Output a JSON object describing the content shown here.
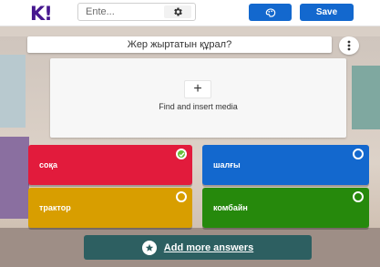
{
  "app": {
    "logo_text": "K!",
    "title_placeholder": "Ente...",
    "save_label": "Save"
  },
  "question": {
    "text": "Жер жыртатын құрал?"
  },
  "media": {
    "plus": "+",
    "label": "Find and insert media"
  },
  "answers": [
    {
      "label": "соқа",
      "correct": true,
      "color": "#e21b3c"
    },
    {
      "label": "шалғы",
      "correct": false,
      "color": "#1368ce"
    },
    {
      "label": "трактор",
      "correct": false,
      "color": "#d89e00"
    },
    {
      "label": "комбайн",
      "correct": false,
      "color": "#26890c"
    }
  ],
  "add_more": {
    "label": "Add more answers"
  },
  "icons": [
    "gear-icon",
    "theme-icon",
    "kebab-icon",
    "plus-icon",
    "check-icon",
    "star-icon"
  ]
}
